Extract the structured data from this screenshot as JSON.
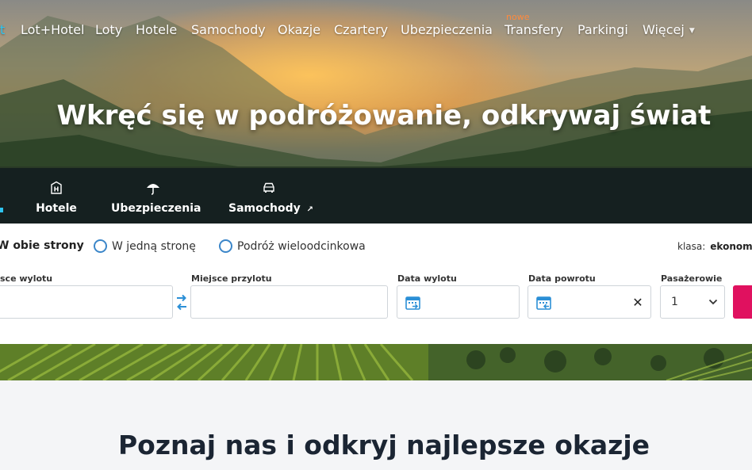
{
  "nav": {
    "items": [
      {
        "label": "t",
        "active": true
      },
      {
        "label": "Lot+Hotel"
      },
      {
        "label": "Loty"
      },
      {
        "label": "Hotele"
      },
      {
        "label": "Samochody"
      },
      {
        "label": "Okazje"
      },
      {
        "label": "Czartery"
      },
      {
        "label": "Ubezpieczenia"
      },
      {
        "label": "Transfery",
        "badge": "nowe"
      },
      {
        "label": "Parkingi"
      },
      {
        "label": "Więcej",
        "has_dropdown": true
      }
    ]
  },
  "hero": {
    "title": "Wkręć się w podróżowanie, odkrywaj świat"
  },
  "tabs": [
    {
      "label": "Hotele",
      "icon": "hotel-icon"
    },
    {
      "label": "Ubezpieczenia",
      "icon": "umbrella-icon"
    },
    {
      "label": "Samochody",
      "icon": "car-icon",
      "external": true
    }
  ],
  "search": {
    "trip_types": [
      {
        "label": "W obie strony",
        "selected": true
      },
      {
        "label": "W jedną stronę",
        "selected": false
      },
      {
        "label": "Podróż wieloodcinkowa",
        "selected": false
      }
    ],
    "class_label": "klasa:",
    "class_value": "ekonomi",
    "fields": {
      "departure_label": "sce wylotu",
      "arrival_label": "Miejsce przylotu",
      "depart_date_label": "Data wylotu",
      "return_date_label": "Data powrotu",
      "passengers_label": "Pasażerowie"
    },
    "passengers_value": "1",
    "clear_symbol": "✕"
  },
  "section": {
    "title": "Poznaj nas i odkryj najlepsze okazje"
  },
  "colors": {
    "accent": "#2ec4f0",
    "brand_pink": "#e0115f",
    "new_badge": "#ff8a3d",
    "radio": "#3b86c9"
  }
}
